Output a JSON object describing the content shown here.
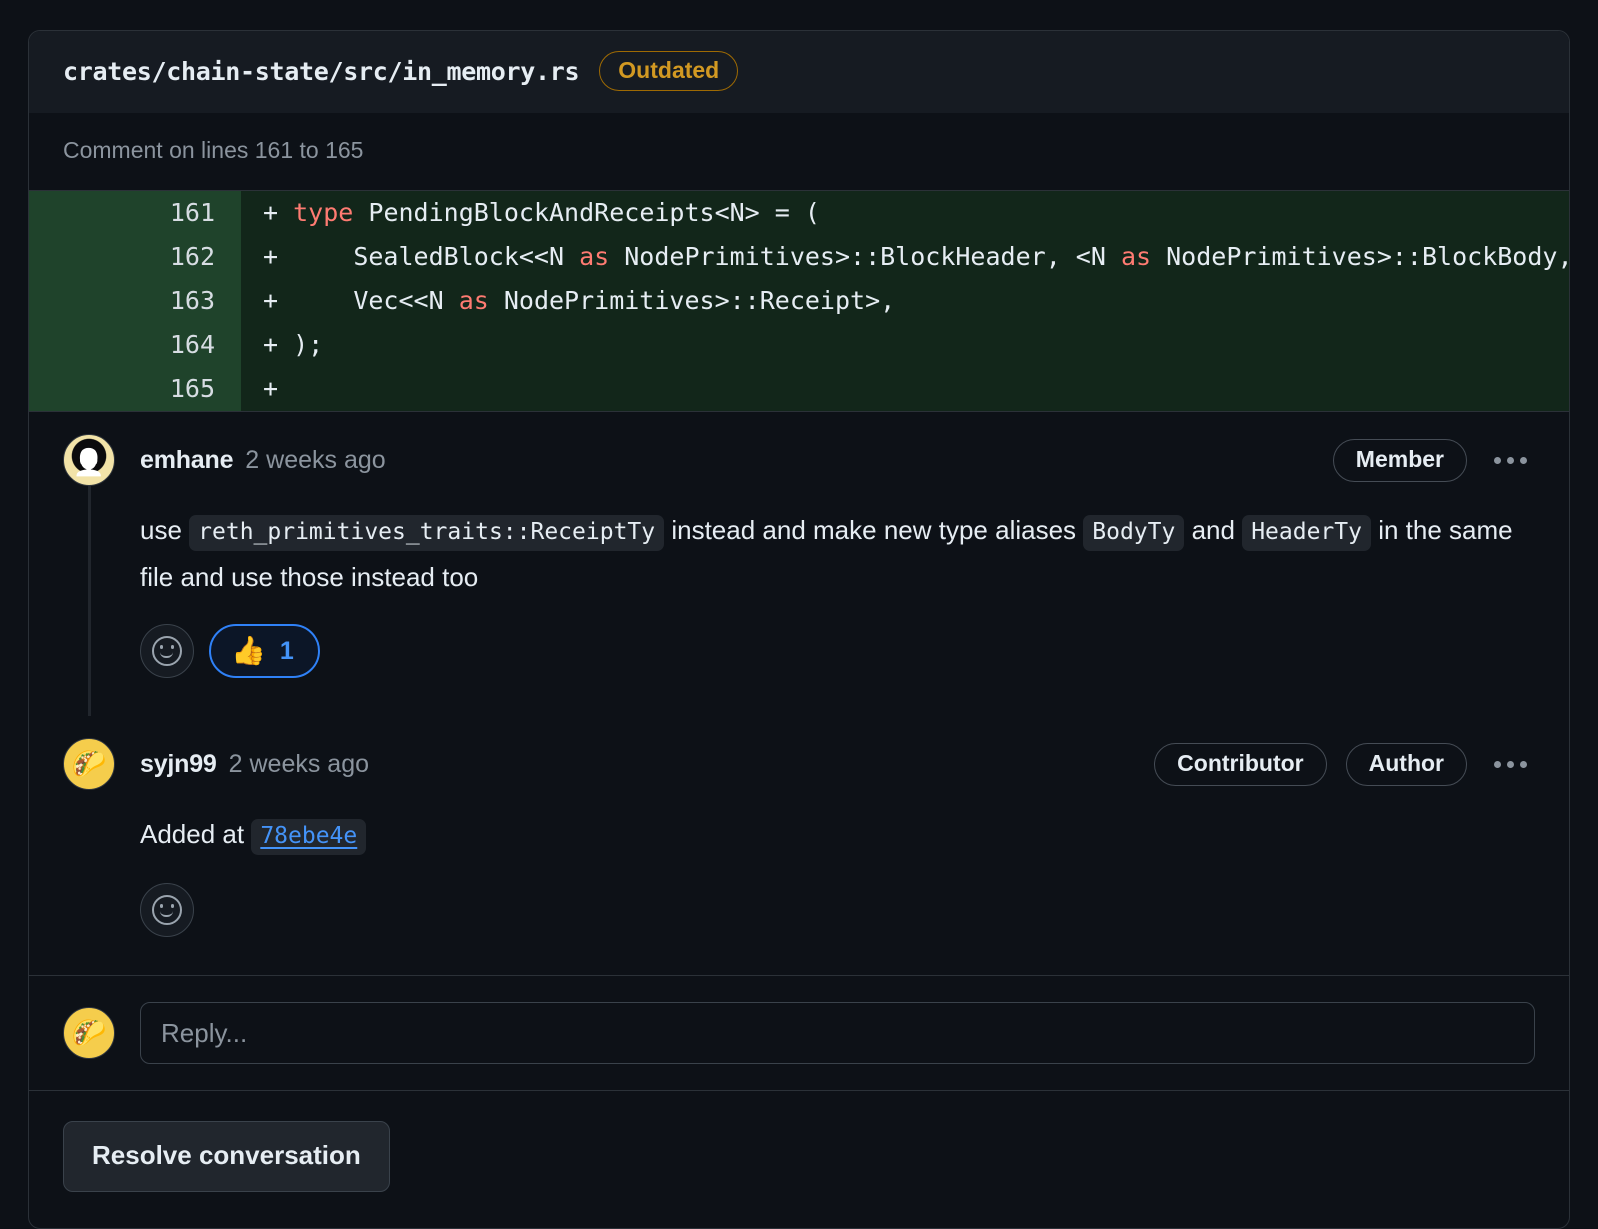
{
  "file": {
    "path": "crates/chain-state/src/in_memory.rs",
    "outdated_badge": "Outdated"
  },
  "lines_note": "Comment on lines 161 to 165",
  "diff": {
    "rows": [
      {
        "number": "161",
        "marker": "+",
        "pre": " ",
        "kw1": "type",
        "rest": " PendingBlockAndReceipts<N> = ("
      },
      {
        "number": "162",
        "marker": "+",
        "pre": "     SealedBlock<<N ",
        "kw1": "as",
        "mid": " NodePrimitives>::BlockHeader, <N ",
        "kw2": "as",
        "rest": " NodePrimitives>::BlockBody,"
      },
      {
        "number": "163",
        "marker": "+",
        "pre": "     Vec<<N ",
        "kw1": "as",
        "rest": " NodePrimitives>::Receipt>,"
      },
      {
        "number": "164",
        "marker": "+",
        "pre": " );",
        "kw1": "",
        "rest": ""
      },
      {
        "number": "165",
        "marker": "+",
        "pre": "",
        "kw1": "",
        "rest": ""
      }
    ]
  },
  "comments": [
    {
      "author": "emhane",
      "timestamp": "2 weeks ago",
      "avatar_glyph": "👤",
      "badges": [
        "Member"
      ],
      "body": {
        "t1": "use ",
        "c1": "reth_primitives_traits::ReceiptTy",
        "t2": " instead and make new type aliases ",
        "c2": "BodyTy",
        "t3": " and ",
        "c3": "HeaderTy",
        "t4": " in the same file and use those instead too"
      },
      "reactions": [
        {
          "emoji": "👍",
          "count": "1"
        }
      ]
    },
    {
      "author": "syjn99",
      "timestamp": "2 weeks ago",
      "avatar_glyph": "🌮",
      "badges": [
        "Contributor",
        "Author"
      ],
      "body": {
        "t1": "Added at ",
        "link": "78ebe4e"
      },
      "reactions": []
    }
  ],
  "reply": {
    "placeholder": "Reply...",
    "avatar_glyph": "🌮"
  },
  "footer": {
    "resolve_label": "Resolve conversation"
  },
  "colors": {
    "accent_blue": "#4493f8",
    "outdated_amber": "#d29922",
    "diff_add_bg": "#12261a",
    "diff_gutter_bg": "#1f432b",
    "page_bg": "#0d1117"
  }
}
